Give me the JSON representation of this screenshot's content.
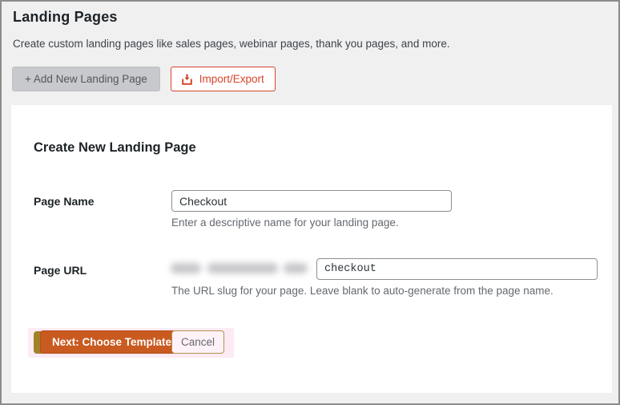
{
  "page": {
    "title": "Landing Pages",
    "description": "Create custom landing pages like sales pages, webinar pages, thank you pages, and more."
  },
  "toolbar": {
    "add_label": "+ Add New Landing Page",
    "import_label": "Import/Export",
    "import_icon": "download-icon"
  },
  "card": {
    "heading": "Create New Landing Page"
  },
  "form": {
    "page_name": {
      "label": "Page Name",
      "value": "Checkout",
      "help": "Enter a descriptive name for your landing page."
    },
    "page_url": {
      "label": "Page URL",
      "prefix_redacted": true,
      "value": "checkout",
      "help": "The URL slug for your page. Leave blank to auto-generate from the page name."
    }
  },
  "actions": {
    "next_label": "Next: Choose Template",
    "cancel_label": "Cancel"
  },
  "colors": {
    "accent_orange": "#c95a20",
    "import_accent": "#d6452b",
    "highlight_pink": "#fcebf4",
    "marker_olive": "#a08229",
    "page_background": "#f0f0f1"
  }
}
